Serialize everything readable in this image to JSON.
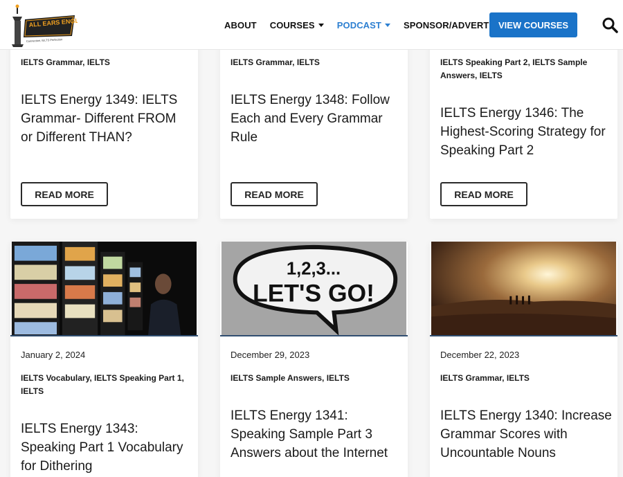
{
  "header": {
    "logo_text": "ALL EARS ENGLISH",
    "logo_tagline": "Connection, IELTS Perfection",
    "nav": [
      {
        "label": "About",
        "has_dropdown": false,
        "active": false
      },
      {
        "label": "Courses",
        "has_dropdown": true,
        "active": false
      },
      {
        "label": "Podcast",
        "has_dropdown": true,
        "active": true
      },
      {
        "label": "Sponsor/Advertise",
        "has_dropdown": false,
        "active": false
      }
    ],
    "cta_label": "View Courses",
    "search_icon": "search-icon"
  },
  "colors": {
    "accent": "#1a73c8",
    "active_nav": "#2c7fd1",
    "text": "#1a1a1a",
    "background": "#f6f6f6"
  },
  "read_more_label": "Read More",
  "posts_top": [
    {
      "categories": "IELTS Grammar, IELTS",
      "title": "IELTS Energy 1349: IELTS Grammar- Different FROM or Different THAN?"
    },
    {
      "categories": "IELTS Grammar, IELTS",
      "title": "IELTS Energy 1348: Follow Each and Every Grammar Rule"
    },
    {
      "categories": "IELTS Speaking Part 2, IELTS Sample Answers, IELTS",
      "title": "IELTS Energy 1346: The Highest-Scoring Strategy for Speaking Part 2"
    }
  ],
  "posts_bottom": [
    {
      "date": "January 2, 2024",
      "categories": "IELTS Vocabulary, IELTS Speaking Part 1, IELTS",
      "title": "IELTS Energy 1343: Speaking Part 1 Vocabulary for Dithering",
      "image": "man-at-vending-machines"
    },
    {
      "date": "December 29, 2023",
      "categories": "IELTS Sample Answers, IELTS",
      "title": "IELTS Energy 1341: Speaking Sample Part 3 Answers about the Internet",
      "image": "lets-go-speech-bubble",
      "image_text_top": "1,2,3...",
      "image_text_bottom": "LET'S GO!"
    },
    {
      "date": "December 22, 2023",
      "categories": "IELTS Grammar, IELTS",
      "title": "IELTS Energy 1340: Increase Grammar Scores with Uncountable Nouns",
      "image": "desert-sunset-walkers"
    }
  ]
}
